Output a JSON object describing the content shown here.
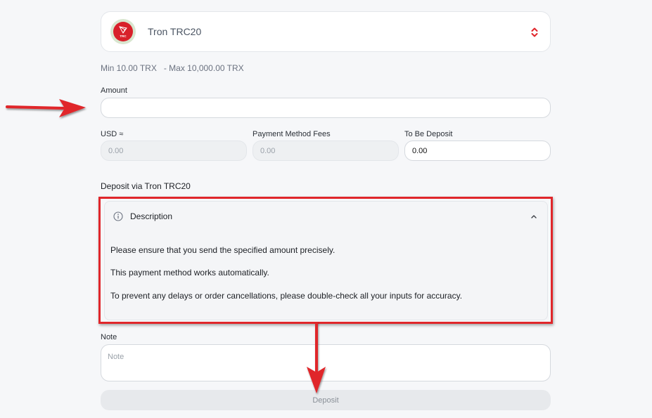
{
  "currency": {
    "name": "Tron TRC20",
    "logo_text": "TRC",
    "limits_text": "Min 10.00 TRX   - Max 10,000.00 TRX"
  },
  "amount": {
    "label": "Amount",
    "value": ""
  },
  "usd": {
    "label": "USD ≈",
    "placeholder": "0.00"
  },
  "fees": {
    "label": "Payment Method Fees",
    "placeholder": "0.00"
  },
  "to_be_deposit": {
    "label": "To Be Deposit",
    "value": "0.00"
  },
  "deposit_via": "Deposit via Tron TRC20",
  "description": {
    "title": "Description",
    "lines": [
      "Please ensure that you send the specified amount precisely.",
      "This payment method works automatically.",
      "To prevent any delays or order cancellations, please double-check all your inputs for accuracy."
    ]
  },
  "note": {
    "label": "Note",
    "placeholder": "Note"
  },
  "deposit_button": "Deposit",
  "colors": {
    "accent_red": "#e0262b",
    "tron_red": "#d8202a",
    "page_bg": "#f6f7f9"
  },
  "icons": {
    "logo": "tron-logo-icon",
    "select": "select-caret-icon",
    "info": "info-icon",
    "collapse": "chevron-up-icon"
  }
}
